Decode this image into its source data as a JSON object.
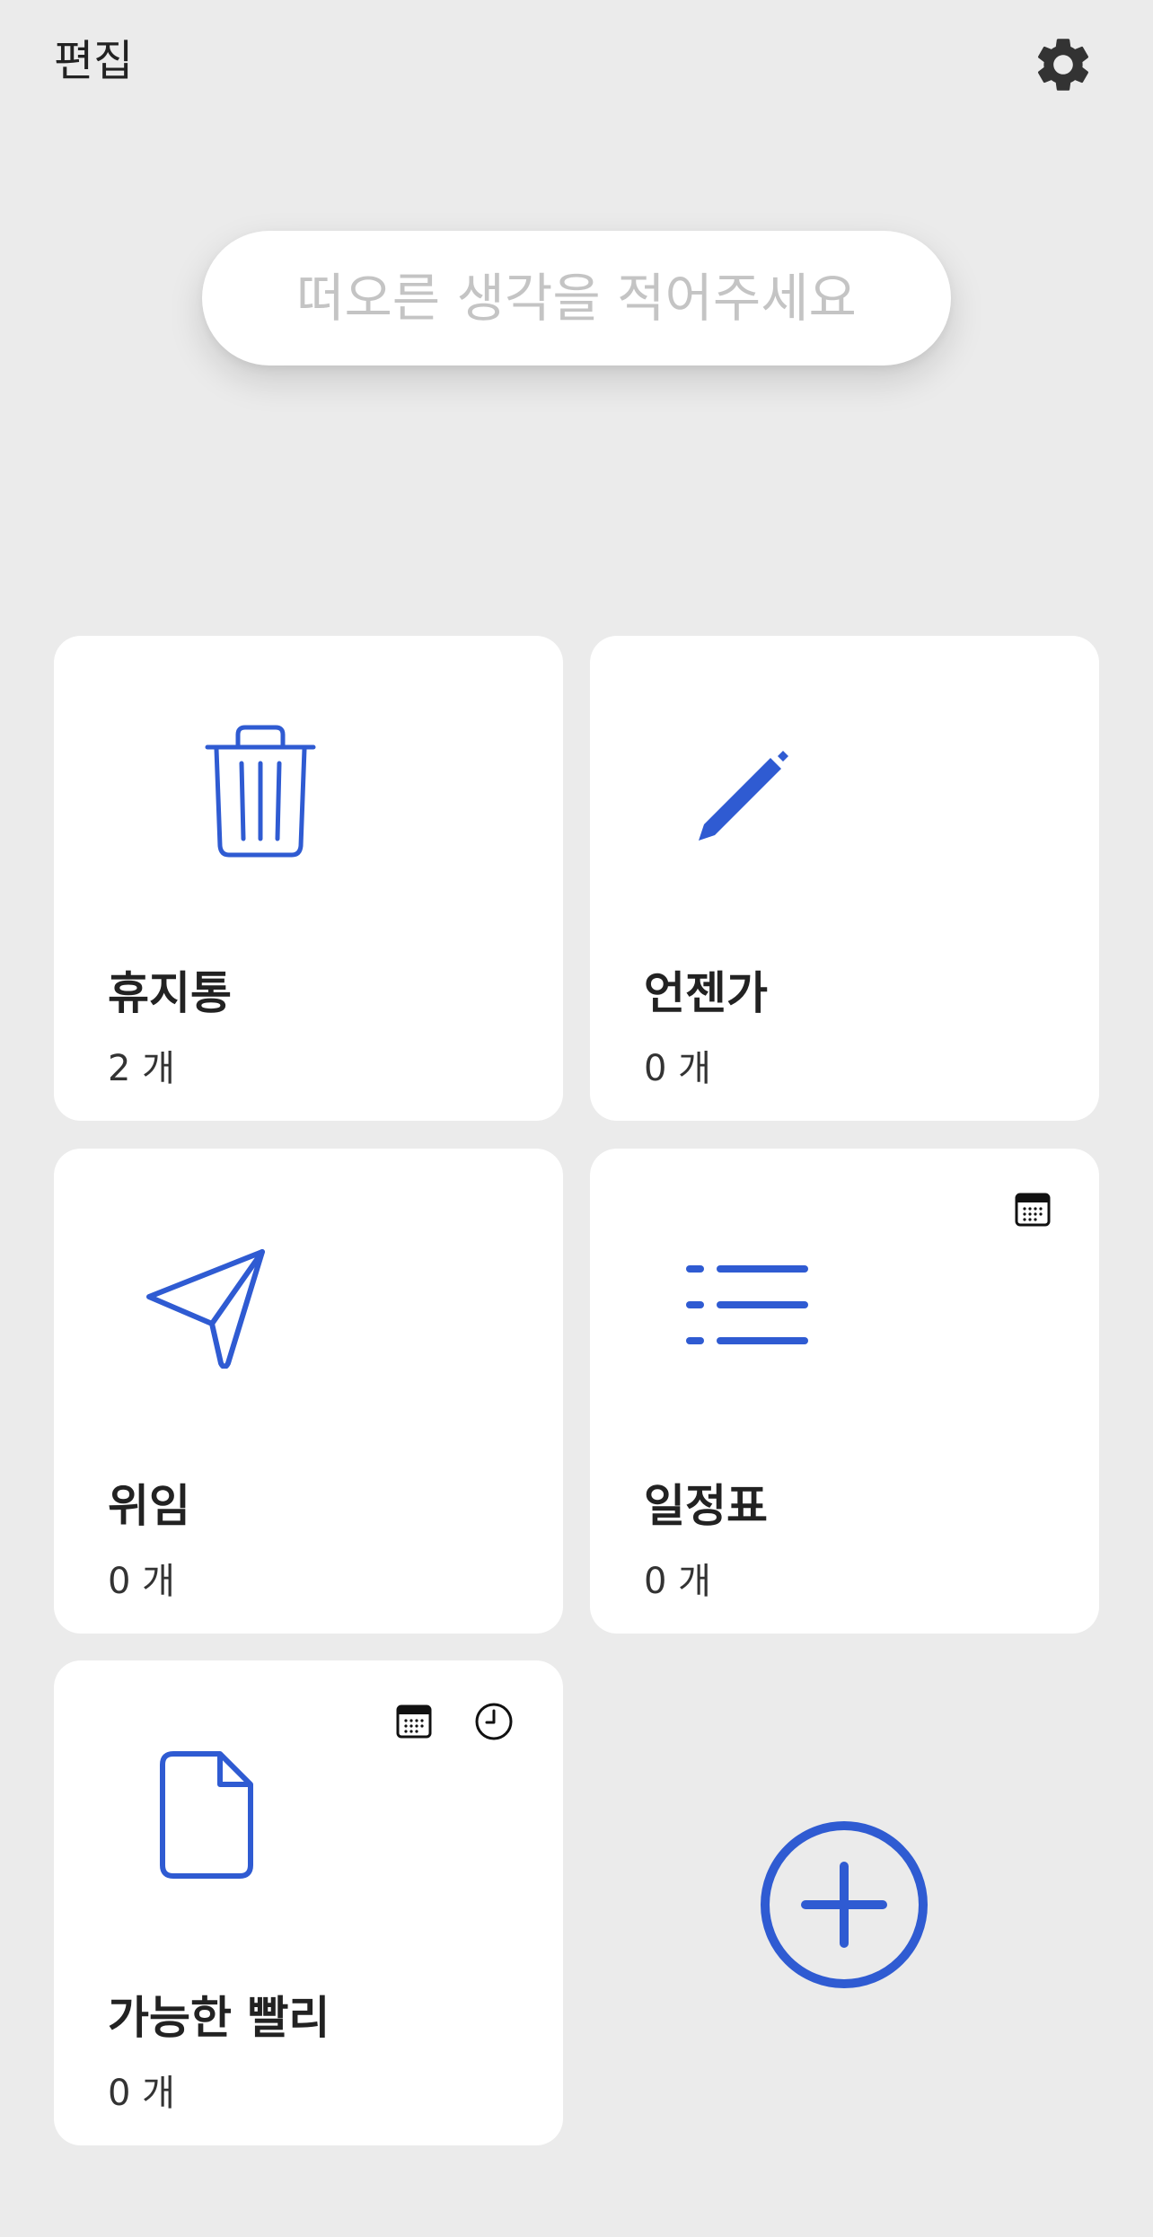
{
  "header": {
    "edit_label": "편집",
    "settings_icon": "gear-icon"
  },
  "thought_input": {
    "value": "",
    "placeholder": "떠오른 생각을 적어주세요"
  },
  "accent_color": "#2f5bd2",
  "cards": [
    {
      "icon": "trash-icon",
      "title": "휴지통",
      "count": "2 개"
    },
    {
      "icon": "pencil-icon",
      "title": "언젠가",
      "count": "0 개"
    },
    {
      "icon": "paper-plane-icon",
      "title": "위임",
      "count": "0 개"
    },
    {
      "icon": "list-icon",
      "title": "일정표",
      "count": "0 개",
      "badges": [
        "calendar-icon"
      ]
    },
    {
      "icon": "document-icon",
      "title": "가능한 빨리",
      "count": "0 개",
      "badges": [
        "calendar-icon",
        "clock-icon"
      ]
    }
  ],
  "add_button": {
    "icon": "plus-circle-icon"
  }
}
